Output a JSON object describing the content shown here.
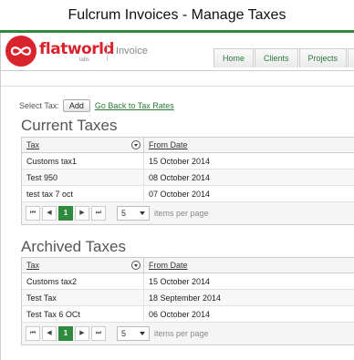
{
  "window": {
    "title": "Fulcrum Invoices - Manage Taxes"
  },
  "header": {
    "brand_name": "flatworld",
    "brand_sub": "labs",
    "product": "Invoice",
    "brand_color": "#d9232d",
    "accent_color": "#2e8b3e",
    "nav": [
      "Home",
      "Clients",
      "Projects",
      "In"
    ]
  },
  "select_tax": {
    "label": "Select Tax:",
    "add_label": "Add",
    "back_link": "Go Back to Tax Rates"
  },
  "current": {
    "title": "Current Taxes",
    "columns": [
      "Tax",
      "From Date"
    ],
    "rows": [
      {
        "tax": "Customs tax1",
        "from": "15 October 2014"
      },
      {
        "tax": "Test 950",
        "from": "08 October 2014"
      },
      {
        "tax": "test tax 7 oct",
        "from": "07 October 2014"
      }
    ],
    "pager": {
      "first": "⏮",
      "prev": "◀",
      "page": "1",
      "next": "▶",
      "last": "⏭",
      "page_size": "5",
      "items_label": "items per page"
    }
  },
  "archived": {
    "title": "Archived Taxes",
    "columns": [
      "Tax",
      "From Date"
    ],
    "rows": [
      {
        "tax": "Customs tax2",
        "from": "15 October 2014"
      },
      {
        "tax": "Test Tax",
        "from": "18 September 2014"
      },
      {
        "tax": "Test Tax 6 OCt",
        "from": "06 October 2014"
      }
    ],
    "pager": {
      "first": "⏮",
      "prev": "◀",
      "page": "1",
      "next": "▶",
      "last": "⏭",
      "page_size": "5",
      "items_label": "items per page"
    }
  }
}
